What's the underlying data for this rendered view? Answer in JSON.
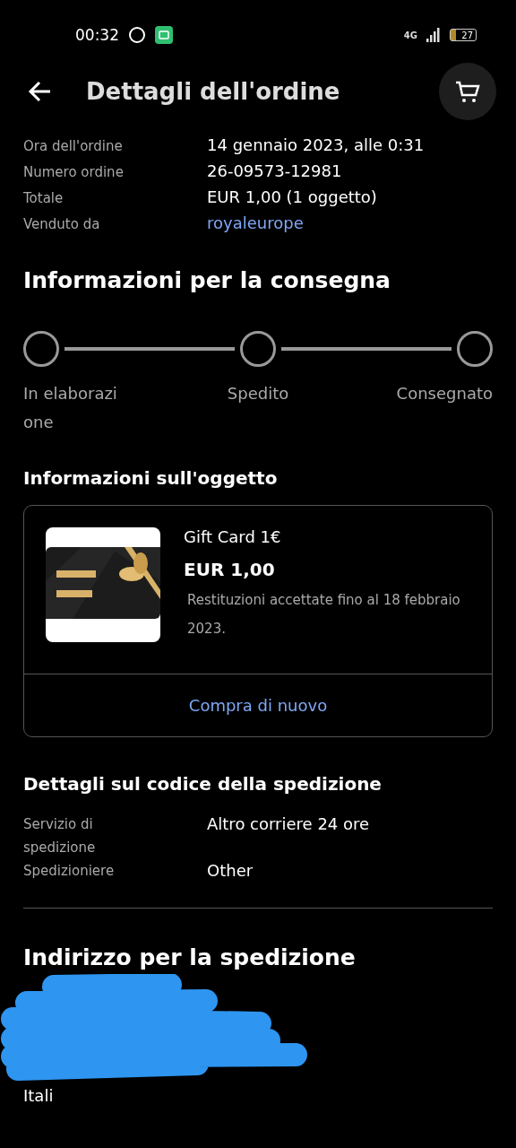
{
  "status_bar": {
    "time": "00:32",
    "network": "4G",
    "battery": "27"
  },
  "header": {
    "title": "Dettagli dell'ordine"
  },
  "order_info": [
    {
      "label": "Ora dell'ordine",
      "value": "14 gennaio 2023, alle 0:31",
      "kind": "text"
    },
    {
      "label": "Numero ordine",
      "value": "26-09573-12981",
      "kind": "text"
    },
    {
      "label": "Totale",
      "value": "EUR 1,00 (1 oggetto)",
      "kind": "text"
    },
    {
      "label": "Venduto da",
      "value": "royaleurope",
      "kind": "link"
    }
  ],
  "delivery": {
    "title": "Informazioni per la consegna",
    "steps": [
      {
        "label": "In elaborazione",
        "done": false
      },
      {
        "label": "Spedito",
        "done": false
      },
      {
        "label": "Consegnato",
        "done": false
      }
    ]
  },
  "item": {
    "section_title": "Informazioni sull'oggetto",
    "name": "Gift Card 1€",
    "price": "EUR 1,00",
    "returns": "Restituzioni accettate fino al 18 febbraio 2023.",
    "action": "Compra di nuovo"
  },
  "shipping": {
    "title": "Dettagli sul codice della spedizione",
    "rows": [
      {
        "label": "Servizio di spedizione",
        "value": "Altro corriere 24 ore"
      },
      {
        "label": "Spedizioniere",
        "value": "Other"
      }
    ]
  },
  "address": {
    "title": "Indirizzo per la spedizione",
    "country": "Itali"
  }
}
